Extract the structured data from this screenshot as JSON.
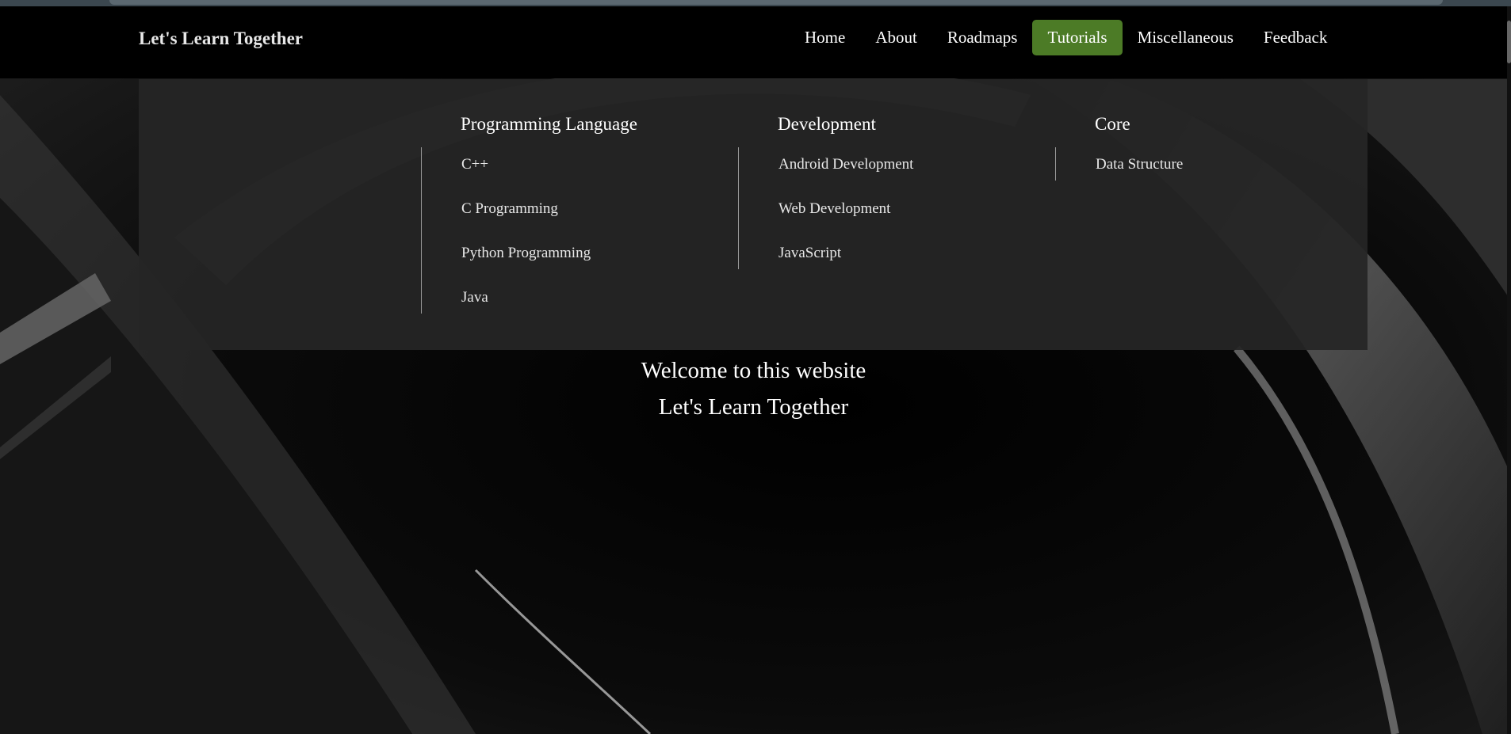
{
  "navbar": {
    "brand": "Let's Learn Together",
    "items": [
      {
        "label": "Home",
        "active": false
      },
      {
        "label": "About",
        "active": false
      },
      {
        "label": "Roadmaps",
        "active": false
      },
      {
        "label": "Tutorials",
        "active": true
      },
      {
        "label": "Miscellaneous",
        "active": false
      },
      {
        "label": "Feedback",
        "active": false
      }
    ],
    "active_color": "#4c7b26"
  },
  "dropdown": {
    "columns": [
      {
        "title": "Programming Language",
        "items": [
          "C++",
          "C Programming",
          "Python Programming",
          "Java"
        ]
      },
      {
        "title": "Development",
        "items": [
          "Android Development",
          "Web Development",
          "JavaScript"
        ]
      },
      {
        "title": "Core",
        "items": [
          "Data Structure"
        ]
      }
    ]
  },
  "hero": {
    "line1": "Welcome to this website",
    "line2": "Let's Learn Together"
  }
}
